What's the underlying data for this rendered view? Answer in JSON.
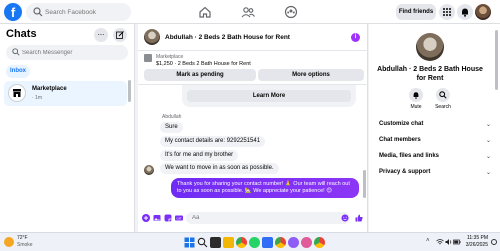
{
  "topbar": {
    "logo": "f",
    "search_placeholder": "Search Facebook",
    "find_friends": "Find friends"
  },
  "chats": {
    "title": "Chats",
    "dots": "...",
    "search_placeholder": "Search Messenger",
    "inbox_tab": "Inbox",
    "conversation": {
      "name": "Marketplace",
      "time": "· 1m"
    }
  },
  "conversation": {
    "title": "Abdullah · 2 Beds 2 Bath House for Rent",
    "info_icon": "i",
    "listing": {
      "label": "Marketplace",
      "title": "$1,250 · 2 Beds 2 Bath House for Rent",
      "pending_button": "Mark as pending",
      "options_button": "More options"
    },
    "learn_more": "Learn More",
    "sender": "Abdullah",
    "messages_in": [
      "Sure",
      "My contact details are: 9292251541",
      "It's for me and my brother",
      "We want to move in as soon as possible."
    ],
    "message_out": "Thank you for sharing your contact number! 🙏 Our team will reach out to you as soon as possible. 🏡 We appreciate your patience! 😊",
    "composer_placeholder": "Aa"
  },
  "profile": {
    "name": "Abdullah · 2 Beds 2 Bath House for Rent",
    "mute_label": "Mute",
    "search_label": "Search",
    "sections": [
      "Customize chat",
      "Chat members",
      "Media, files and links",
      "Privacy & support"
    ]
  },
  "taskbar": {
    "temp": "72°F",
    "condition": "Smoke",
    "time": "11:35 PM",
    "date": "3/26/2025",
    "tray_arrow": "˄"
  },
  "colors": {
    "brand": "#1877f2",
    "outgoing_bubble": "#7b2ff7",
    "info_dot": "#a033ff"
  }
}
